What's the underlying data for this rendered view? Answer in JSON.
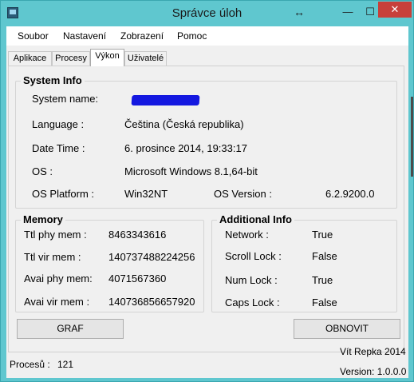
{
  "window": {
    "title": "Správce úloh",
    "resize_glyph": "↔",
    "minimize_glyph": "—",
    "maximize_glyph": "☐",
    "close_glyph": "✕",
    "accent_color": "#5fc7cf",
    "close_color": "#c7403a"
  },
  "menu": [
    "Soubor",
    "Nastavení",
    "Zobrazení",
    "Pomoc"
  ],
  "tabs": [
    {
      "label": "Aplikace",
      "active": false
    },
    {
      "label": "Procesy",
      "active": false
    },
    {
      "label": "Výkon",
      "active": true
    },
    {
      "label": "Uživatelé",
      "active": false
    }
  ],
  "system_info": {
    "title": "System Info",
    "system_name_label": "System name:",
    "system_name_value_redacted": true,
    "language_label": "Language  :",
    "language_value": "Čeština (Česká republika)",
    "datetime_label": "Date  Time  :",
    "datetime_value": "6. prosince 2014, 19:33:17",
    "os_label": "OS  :",
    "os_value": "Microsoft Windows 8.1,64-bit",
    "platform_label": "OS Platform  :",
    "platform_value": "Win32NT",
    "version_label": "OS Version  :",
    "version_value": "6.2.9200.0"
  },
  "memory": {
    "title": "Memory",
    "ttl_phy_label": "Ttl phy mem  :",
    "ttl_phy_value": "8463343616",
    "ttl_vir_label": "Ttl vir mem  :",
    "ttl_vir_value": "140737488224256",
    "avai_phy_label": "Avai phy mem:",
    "avai_phy_value": "4071567360",
    "avai_vir_label": "Avai vir mem  :",
    "avai_vir_value": "140736856657920"
  },
  "additional_info": {
    "title": "Additional Info",
    "network_label": "Network  :",
    "network_value": "True",
    "scroll_label": "Scroll Lock  :",
    "scroll_value": "False",
    "num_label": "Num Lock  :",
    "num_value": "True",
    "caps_label": "Caps Lock  :",
    "caps_value": "False"
  },
  "buttons": {
    "graf": "GRAF",
    "obnovit": "OBNOVIT"
  },
  "footer": {
    "processes_label": "Procesů  :",
    "processes_value": "121",
    "author": "Vít Repka 2014",
    "version": "Version: 1.0.0.0"
  }
}
